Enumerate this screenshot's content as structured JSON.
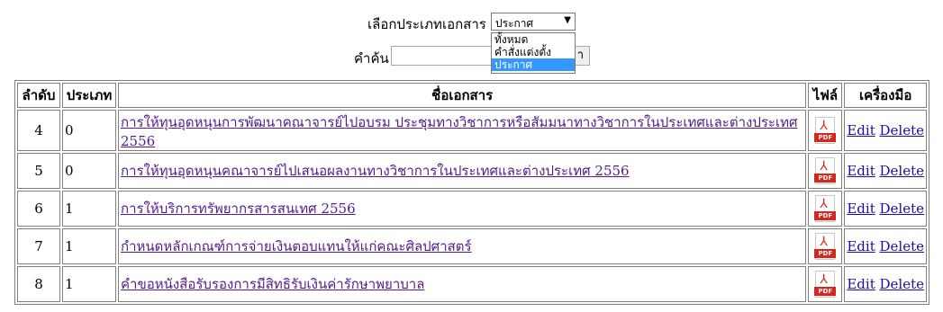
{
  "filter": {
    "type_label": "เลือกประเภทเอกสาร",
    "selected": "ประกาศ",
    "options": [
      "ทั้งหมด",
      "คำสั่งแต่งตั้ง",
      "ประกาศ"
    ],
    "search_label": "คำค้น",
    "search_value": "",
    "search_button": "า"
  },
  "table": {
    "headers": [
      "ลำดับ",
      "ประเภท",
      "ชื่อเอกสาร",
      "ไฟล์",
      "เครื่องมือ"
    ],
    "rows": [
      {
        "no": "4",
        "type": "0",
        "title": "การให้ทุนอุดหนุนการพัฒนาคณาจารย์ไปอบรม ประชุมทางวิชาการหรือสัมมนาทางวิชาการในประเทศและต่างประเทศ 2556"
      },
      {
        "no": "5",
        "type": "0",
        "title": "การให้ทุนอุดหนุนคณาจารย์ไปเสนอผลงานทางวิชาการในประเทศและต่างประเทศ 2556"
      },
      {
        "no": "6",
        "type": "1",
        "title": "การให้บริการทรัพยากรสารสนเทศ 2556"
      },
      {
        "no": "7",
        "type": "1",
        "title": "กำหนดหลักเกณฑ์การจ่ายเงินตอบแทนให้แก่คณะศิลปศาสตร์"
      },
      {
        "no": "8",
        "type": "1",
        "title": "คำขอหนังสือรับรองการมีสิทธิรับเงินค่ารักษาพยาบาล"
      }
    ],
    "edit_label": "Edit",
    "delete_label": "Delete",
    "file_icon_label": "PDF"
  }
}
